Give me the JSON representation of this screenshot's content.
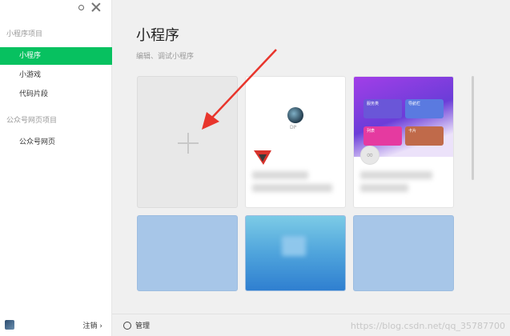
{
  "sidebar": {
    "section1_title": "小程序项目",
    "items": [
      {
        "label": "小程序"
      },
      {
        "label": "小游戏"
      },
      {
        "label": "代码片段"
      }
    ],
    "section2_title": "公众号网页项目",
    "section2_items": [
      {
        "label": "公众号网页"
      }
    ],
    "logout_label": "注销 ›"
  },
  "main": {
    "title": "小程序",
    "subtitle": "编辑、调试小程序",
    "manage_label": "管理",
    "project_cards": [
      {
        "caption": "DP"
      }
    ],
    "tiles": [
      {
        "label": "服务类",
        "color": "#6a56d8"
      },
      {
        "label": "导航栏",
        "color": "#5a7ae0"
      },
      {
        "label": "列表",
        "color": "#e53aa0"
      },
      {
        "label": "卡片",
        "color": "#c06a4a"
      }
    ]
  },
  "watermark": "https://blog.csdn.net/qq_35787700",
  "colors": {
    "accent": "#07c160",
    "arrow": "#e8352c"
  },
  "icons": {
    "add": "plus-icon",
    "settings": "gear-icon",
    "link": "link-icon"
  }
}
